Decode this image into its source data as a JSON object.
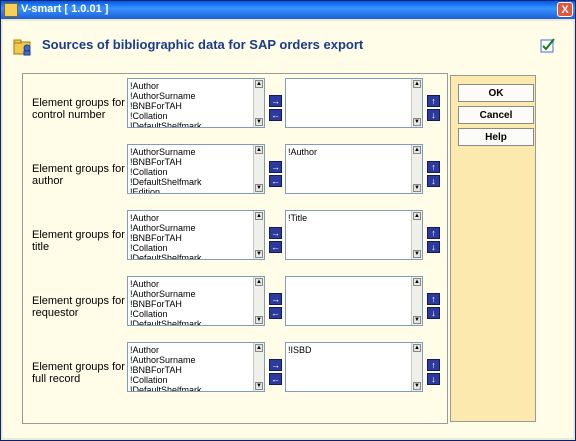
{
  "window": {
    "title": "V-smart [ 1.0.01 ]",
    "close_glyph": "X"
  },
  "page": {
    "title": "Sources of bibliographic data for SAP orders export"
  },
  "buttons": {
    "ok": "OK",
    "cancel": "Cancel",
    "help": "Help"
  },
  "icons": {
    "arrow_right": "→",
    "arrow_left": "←",
    "arrow_up": "↑",
    "arrow_down": "↓",
    "scroll_up": "▲",
    "scroll_down": "▼"
  },
  "rows": [
    {
      "label_line1": "Element groups for",
      "label_line2": "control number",
      "available": [
        "!Author",
        "!AuthorSurname",
        "!BNBForTAH",
        "!Collation",
        "!DefaultShelfmark"
      ],
      "selected": []
    },
    {
      "label_line1": "Element groups for",
      "label_line2": "author",
      "available": [
        "!AuthorSurname",
        "!BNBForTAH",
        "!Collation",
        "!DefaultShelfmark",
        "!Edition"
      ],
      "selected": [
        "!Author"
      ]
    },
    {
      "label_line1": "Element groups for",
      "label_line2": "title",
      "available": [
        "!Author",
        "!AuthorSurname",
        "!BNBForTAH",
        "!Collation",
        "!DefaultShelfmark"
      ],
      "selected": [
        "!Title"
      ]
    },
    {
      "label_line1": "Element groups for",
      "label_line2": "requestor",
      "available": [
        "!Author",
        "!AuthorSurname",
        "!BNBForTAH",
        "!Collation",
        "!DefaultShelfmark"
      ],
      "selected": []
    },
    {
      "label_line1": "Element groups for",
      "label_line2": "full record",
      "available": [
        "!Author",
        "!AuthorSurname",
        "!BNBForTAH",
        "!Collation",
        "!DefaultShelfmark"
      ],
      "selected": [
        "!ISBD"
      ]
    }
  ]
}
